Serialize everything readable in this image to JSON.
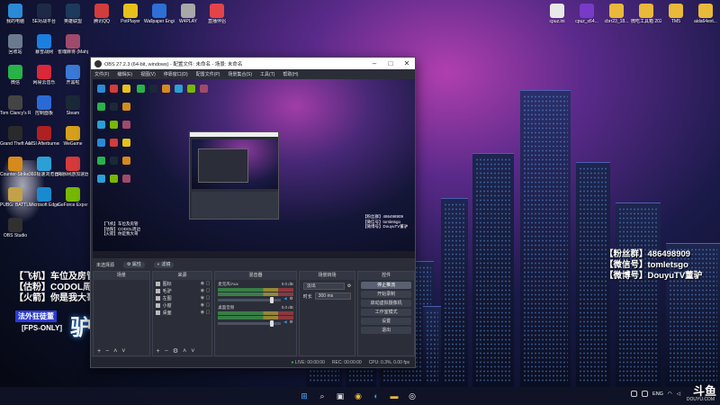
{
  "desktop_icons_left": [
    {
      "label": "我的电脑",
      "icon": "computer-icon",
      "color": "#2a8ad6"
    },
    {
      "label": "5E对战平台",
      "icon": "5e-icon",
      "color": "#1e2a44"
    },
    {
      "label": "英雄联盟",
      "icon": "lol-icon",
      "color": "#1c3a5c"
    },
    {
      "label": "腾讯QQ",
      "icon": "qq-icon",
      "color": "#d23c3c"
    },
    {
      "label": "PotPlayer",
      "icon": "potplayer-icon",
      "color": "#e6c11b"
    },
    {
      "label": "Wallpaper Engine: ...",
      "icon": "wallpaper-engine-icon",
      "color": "#2d6fd6"
    },
    {
      "label": "W4PLAY",
      "icon": "w4play-icon",
      "color": "#a8a8a8"
    },
    {
      "label": "直播伴侣",
      "icon": "live-companion-icon",
      "color": "#e2444a"
    },
    {
      "label": "回收站",
      "icon": "recycle-bin-icon",
      "color": "#6b7a8f"
    },
    {
      "label": "暴雪战网",
      "icon": "battlenet-icon",
      "color": "#1b7fe0"
    },
    {
      "label": "雀魂麻将 (Mahjong...",
      "icon": "mahjong-icon",
      "color": "#a04a6a"
    },
    {
      "label": "微信",
      "icon": "wechat-icon",
      "color": "#29b24a"
    },
    {
      "label": "网易云音乐",
      "icon": "netease-music-icon",
      "color": "#d8283a"
    },
    {
      "label": "开黑啦",
      "icon": "kaiheila-icon",
      "color": "#3a7ad6"
    },
    {
      "label": "Tom Clancy's R...",
      "icon": "rainbow-six-icon",
      "color": "#444"
    },
    {
      "label": "控制面板",
      "icon": "control-panel-icon",
      "color": "#2a6ad6"
    },
    {
      "label": "Steam",
      "icon": "steam-icon",
      "color": "#1b2838"
    },
    {
      "label": "Grand Theft Auto V",
      "icon": "gta-icon",
      "color": "#2a2a2a"
    },
    {
      "label": "MSI Afterburner",
      "icon": "afterburner-icon",
      "color": "#b02020"
    },
    {
      "label": "WeGame",
      "icon": "wegame-icon",
      "color": "#d6a01b"
    },
    {
      "label": "Counter-Strike: Global Off...",
      "icon": "csgo-icon",
      "color": "#d68a1b"
    },
    {
      "label": "360极速浏览器X",
      "icon": "360-browser-icon",
      "color": "#2aa0d6"
    },
    {
      "label": "海豚网游加速器",
      "icon": "dolphin-accelerator-icon",
      "color": "#d63a3a"
    },
    {
      "label": "PUBG: BATTLEGR...",
      "icon": "pubg-icon",
      "color": "#c2a14a"
    },
    {
      "label": "Microsoft Edge",
      "icon": "edge-icon",
      "color": "#1a8ad0"
    },
    {
      "label": "GeForce Experience",
      "icon": "geforce-icon",
      "color": "#76b900"
    },
    {
      "label": "OBS Studio",
      "icon": "obs-icon",
      "color": "#303030"
    }
  ],
  "desktop_icons_right": [
    {
      "label": "cpuz.ini",
      "icon": "ini-file-icon",
      "color": "#e8e8e8"
    },
    {
      "label": "cpuz_x64...",
      "icon": "cpuz-icon",
      "color": "#7a3ac8"
    },
    {
      "label": "cbrr23_18...",
      "icon": "folder-icon",
      "color": "#e8b93a"
    },
    {
      "label": "微吃工具箱 2022.03版",
      "icon": "folder-icon",
      "color": "#e8b93a"
    },
    {
      "label": "TM5",
      "icon": "folder-icon",
      "color": "#e8b93a"
    },
    {
      "label": "aida64ext...",
      "icon": "folder-icon",
      "color": "#e8b93a"
    }
  ],
  "overlay_left": {
    "line1": "【飞机】车位及房管",
    "line2": "【估粉】CODOL周边",
    "line3": "【火箭】你是我大哥",
    "tag": "法外狂徒董",
    "fps": "[FPS-ONLY]",
    "donkey": "驴"
  },
  "overlay_right": {
    "line1": "【粉丝群】486498909",
    "line2": "【微信号】tomletsgo",
    "line3": "【微博号】DouyuTV董驴"
  },
  "obs": {
    "title": "OBS 27.2.3 (64-bit, windows) - 配置文件: 未命名 - 场景: 未命名",
    "menu": [
      "文件(F)",
      "编辑(E)",
      "视图(V)",
      "停靠窗口(D)",
      "配置文件(P)",
      "场景集合(S)",
      "工具(T)",
      "帮助(H)"
    ],
    "preview_text": [
      "【粉丝群】486498909",
      "【微信号】tomletsgo",
      "【微博号】DouyuTV董驴"
    ],
    "preview_left_text": [
      "【飞机】车位及房管",
      "【估粉】CODOL周边",
      "【火箭】你是我大哥"
    ],
    "scene_bar_label": "未选择源",
    "scene_bar_btn1": "属性",
    "scene_bar_btn2": "滤镜",
    "docks": {
      "scenes": "场景",
      "sources": "来源",
      "mixer": "混音器",
      "transitions": "场景转场",
      "controls": "控件"
    },
    "sources": [
      "图标",
      "毛驴",
      "左图",
      "小窗",
      "桌面"
    ],
    "mixer": [
      {
        "label": "麦克风/Aux",
        "level": "0.0 dB"
      },
      {
        "label": "桌面音频",
        "level": "0.0 dB"
      }
    ],
    "transition": {
      "type": "淡出",
      "duration_label": "时长",
      "duration": "300 ms"
    },
    "controls": [
      "停止推流",
      "开始录制",
      "启动虚拟摄像机",
      "工作室模式",
      "设置",
      "退出"
    ],
    "status": {
      "live_label": "LIVE:",
      "live_time": "00:00:00",
      "rec_label": "REC:",
      "rec_time": "00:00:00",
      "cpu": "CPU: 0.3%, 0.00 fps"
    }
  },
  "taskbar": {
    "apps": [
      "start",
      "search",
      "taskview",
      "chrome",
      "edge",
      "explorer",
      "obs"
    ],
    "ime": "ENG",
    "time": "",
    "douyu_logo": "斗鱼",
    "douyu_url": "DOUYU.COM"
  }
}
